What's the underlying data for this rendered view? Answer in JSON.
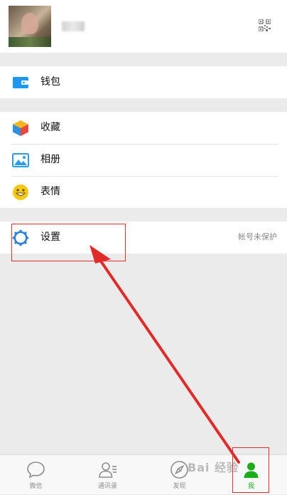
{
  "profile": {
    "nickname": "",
    "qr_icon": "qrcode-icon"
  },
  "groups": [
    {
      "items": [
        {
          "label": "钱包",
          "icon": "wallet-icon"
        }
      ]
    },
    {
      "items": [
        {
          "label": "收藏",
          "icon": "favorites-cube-icon"
        },
        {
          "label": "相册",
          "icon": "album-picture-icon"
        },
        {
          "label": "表情",
          "icon": "sticker-smile-icon"
        }
      ]
    },
    {
      "items": [
        {
          "label": "设置",
          "icon": "settings-gear-icon",
          "hint": "帐号未保护"
        }
      ]
    }
  ],
  "tabbar": {
    "tabs": [
      {
        "label": "微信",
        "icon": "chat-bubble-icon"
      },
      {
        "label": "通讯录",
        "icon": "contacts-icon"
      },
      {
        "label": "发现",
        "icon": "compass-icon"
      },
      {
        "label": "我",
        "icon": "me-person-icon",
        "active": true
      }
    ]
  },
  "watermark": "Bai 经验",
  "colors": {
    "accent_green": "#1aad19",
    "annotation_red": "#e02b2b",
    "page_background": "#ebebeb",
    "wallet_blue": "#1e97f0",
    "settings_blue": "#2b82d9",
    "sticker_yellow": "#f6c816"
  }
}
